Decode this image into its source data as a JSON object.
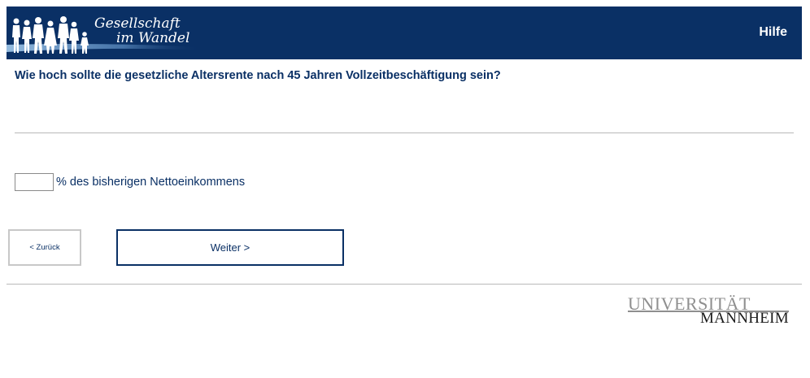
{
  "header": {
    "logo_line1": "Gesellschaft",
    "logo_line2": "im Wandel",
    "help_label": "Hilfe",
    "background_color": "#0a3065"
  },
  "question": {
    "text": "Wie hoch sollte die gesetzliche Altersrente nach 45 Jahren Vollzeitbeschäftigung sein?"
  },
  "answer": {
    "value": "",
    "suffix": "% des bisherigen Nettoeinkommens"
  },
  "navigation": {
    "back_label": "< Zurück",
    "next_label": "Weiter >"
  },
  "footer": {
    "university_line1": "UNIVERSITÄT",
    "university_line2": "MANNHEIM"
  },
  "icons": {
    "logo_people": "people-silhouettes-icon"
  }
}
